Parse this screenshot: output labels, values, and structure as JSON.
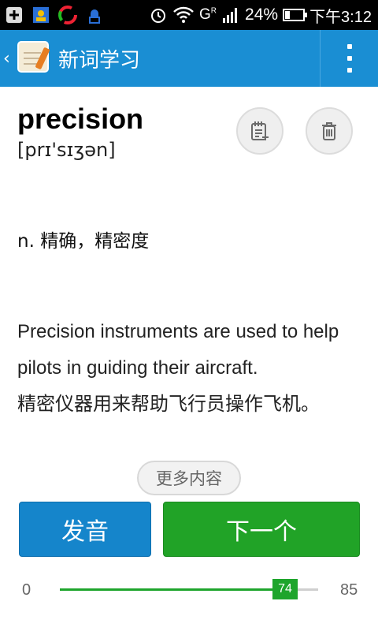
{
  "status_bar": {
    "battery": "24%",
    "time": "下午3:12",
    "icons": [
      "plus-notification-icon",
      "contacts-icon",
      "circle-app-icon",
      "usb-debug-icon",
      "alarm-icon",
      "wifi-icon",
      "signal-icon",
      "battery-icon"
    ],
    "network_type": "G",
    "roaming_marker": "R"
  },
  "action_bar": {
    "title": "新词学习",
    "back_glyph": "‹",
    "overflow_icon": "more-vert-icon"
  },
  "word_card": {
    "word": "precision",
    "phonetic": "[prɪ'sɪʒən]",
    "meaning": "n. 精确，精密度",
    "example_en": "Precision instruments are used to help pilots in guiding their aircraft.",
    "example_zh": "精密仪器用来帮助飞行员操作飞机。",
    "notebook_button_icon": "add-to-notebook-icon",
    "delete_button_icon": "trash-icon"
  },
  "more_button": {
    "label": "更多内容"
  },
  "buttons": {
    "pronounce": "发音",
    "next": "下一个"
  },
  "progress": {
    "min": "0",
    "max": "85",
    "current": "74",
    "current_value": 74,
    "max_value": 85
  },
  "colors": {
    "action_bar": "#1a8ed3",
    "pronounce_button": "#1585cb",
    "next_button": "#21a327",
    "progress": "#1ea52c"
  }
}
